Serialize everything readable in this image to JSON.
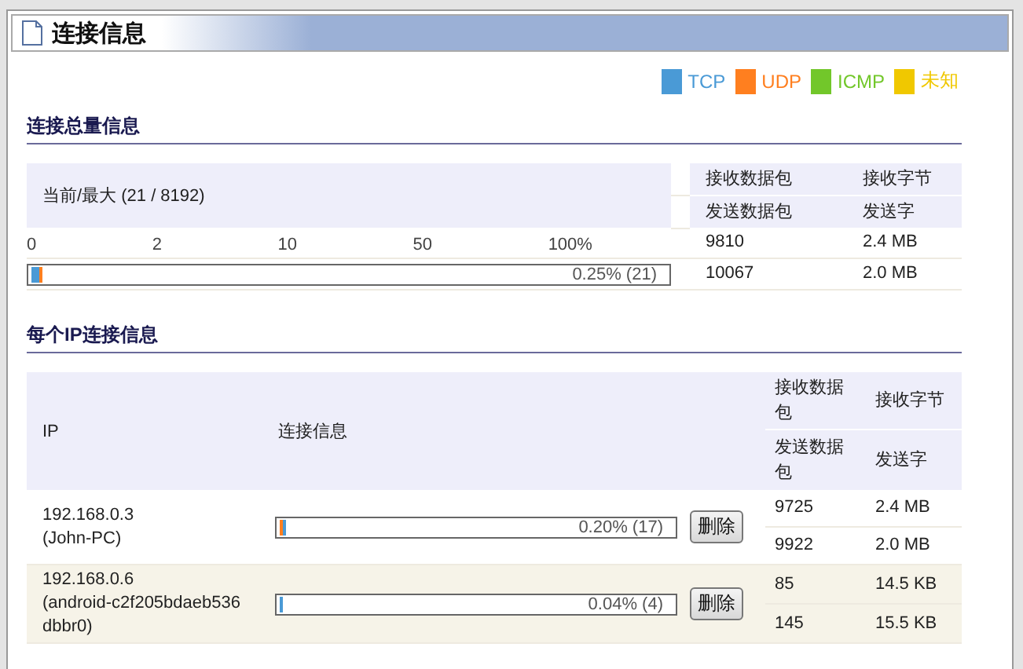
{
  "window": {
    "title": "连接信息"
  },
  "legend": [
    {
      "label": "TCP",
      "color": "#4a9ad6"
    },
    {
      "label": "UDP",
      "color": "#ff7f1f"
    },
    {
      "label": "ICMP",
      "color": "#72c72a"
    },
    {
      "label": "未知",
      "color": "#f0c800"
    }
  ],
  "summary": {
    "title": "连接总量信息",
    "current_max": "当前/最大 (21 / 8192)",
    "columns": [
      [
        "接收数据包",
        "发送数据包"
      ],
      [
        "接收字节",
        "发送字"
      ]
    ],
    "scale": [
      "0",
      "2",
      "10",
      "50",
      "100%"
    ],
    "bar": {
      "segments": [
        {
          "color": "#4a9ad6",
          "level": 0.012
        },
        {
          "color": "#ff7f1f",
          "level": 0.004
        }
      ],
      "reading": "0.25% (21)"
    },
    "received": [
      "9810",
      "2.4 MB"
    ],
    "sent": [
      "10067",
      "2.0 MB"
    ]
  },
  "per_ip": {
    "title": "每个IP连接信息",
    "columns": [
      "IP",
      "连接信息",
      [
        "接收数据包",
        "发送数据包"
      ],
      [
        "接收字节",
        "发送字"
      ]
    ],
    "rows": [
      {
        "ip": "192.168.0.3",
        "host": "(John-PC)",
        "bar": {
          "segments": [
            {
              "color": "#ff7f1f",
              "level": 0.003
            },
            {
              "color": "#4a9ad6",
              "level": 0.003
            }
          ],
          "reading": "0.20% (17)"
        },
        "button": "删除",
        "received": [
          "9725",
          "2.4 MB"
        ],
        "sent": [
          "9922",
          "2.0 MB"
        ]
      },
      {
        "ip": "192.168.0.6",
        "host": "(android-c2f205bdaeb536dbbr0)",
        "bar": {
          "segments": [
            {
              "color": "#4a9ad6",
              "level": 0.007
            }
          ],
          "reading": "0.04% (4)"
        },
        "button": "删除",
        "received": [
          "85",
          "14.5 KB"
        ],
        "sent": [
          "145",
          "15.5 KB"
        ]
      }
    ]
  }
}
